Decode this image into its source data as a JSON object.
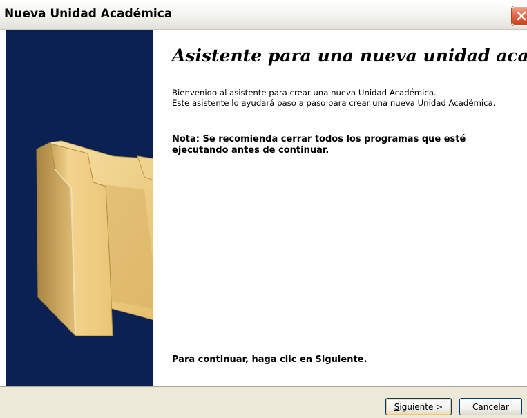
{
  "window": {
    "title": "Nueva Unidad Académica"
  },
  "content": {
    "heading": "Asistente para una nueva unidad académica",
    "intro_line1": "Bienvenido al asistente para crear una nueva Unidad Académica.",
    "intro_line2": "Este asistente lo ayudará paso a paso para crear una nueva Unidad Académica.",
    "note": "Nota: Se recomienda cerrar todos los programas que esté ejecutando antes de continuar.",
    "continue_hint": "Para continuar, haga clic en Siguiente."
  },
  "buttons": {
    "next_mnemonic": "S",
    "next_rest": "iguiente >",
    "cancel": "Cancelar"
  },
  "icons": {
    "close": "close-icon",
    "folder": "folder-icon"
  },
  "colors": {
    "side_panel": "#0b2152",
    "close_button": "#e26a4a",
    "footer": "#ece9d8"
  }
}
